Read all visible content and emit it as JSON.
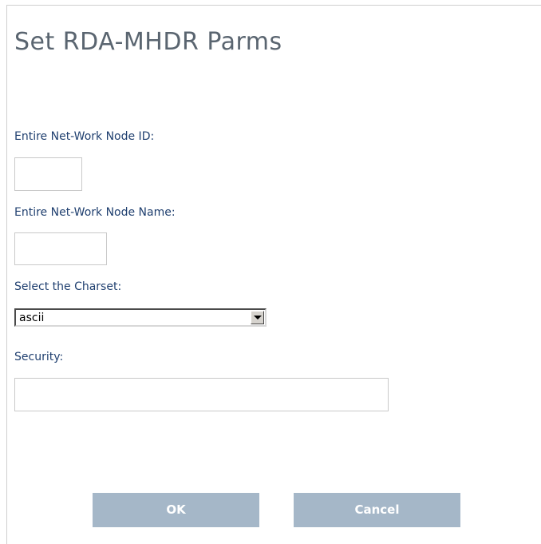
{
  "dialog": {
    "title": "Set RDA-MHDR Parms"
  },
  "form": {
    "node_id": {
      "label": "Entire Net-Work Node ID:",
      "value": ""
    },
    "node_name": {
      "label": "Entire Net-Work Node Name:",
      "value": ""
    },
    "charset": {
      "label": "Select the Charset:",
      "selected": "ascii"
    },
    "security": {
      "label": "Security:",
      "value": ""
    }
  },
  "buttons": {
    "ok_label": "OK",
    "cancel_label": "Cancel"
  },
  "colors": {
    "label": "#1f3f6f",
    "title": "#5a6570",
    "button_bg": "#a5b7c8",
    "button_text": "#ffffff"
  }
}
